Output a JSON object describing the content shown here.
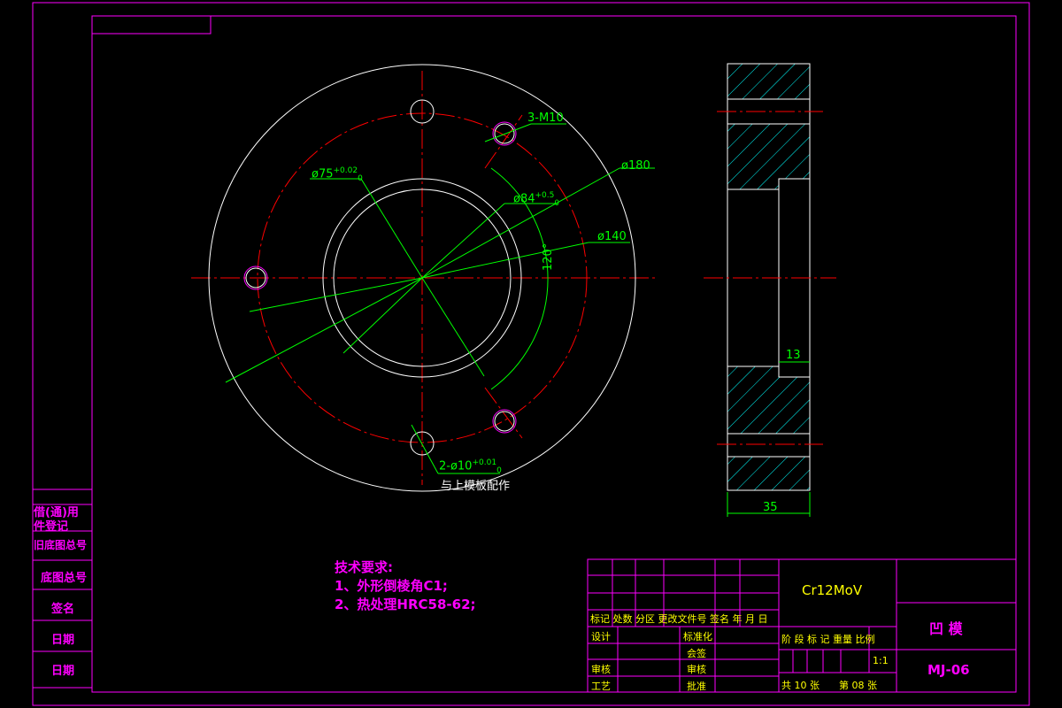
{
  "colors": {
    "frame": "#ff00ff",
    "outline": "#ffffff",
    "center_line": "#ff0000",
    "dimension": "#00ff00",
    "hatch": "#00ffff",
    "title_text": "#ffff00",
    "tech_text": "#ff00ff"
  },
  "dimensions": {
    "thread": "3-M10",
    "dia_180": "ø180",
    "dia_140": "ø140",
    "dia_84": "ø84",
    "dia_84_tol": "+0.5",
    "dia_84_tol_low": "0",
    "dia_75": "ø75",
    "dia_75_tol": "+0.02",
    "dia_75_tol_low": "0",
    "angle": "120°",
    "pin_holes": "2-ø10",
    "pin_tol": "+0.01",
    "pin_tol_low": "0",
    "pin_note": "与上模板配作",
    "depth_13": "13",
    "thickness_35": "35"
  },
  "tech_requirements": {
    "heading": "技术要求:",
    "items": [
      "1、外形倒棱角C1;",
      "2、热处理HRC58-62;"
    ]
  },
  "left_column": [
    "借(通)用",
    "件登记",
    "旧底图总号",
    "底图总号",
    "签名",
    "日期",
    "日期"
  ],
  "title_block": {
    "material": "Cr12MoV",
    "part_name": "凹 模",
    "drawing_no": "MJ-06",
    "header_row": "标记 处数 分区 更改文件号 签名 年 月 日",
    "design": "设计",
    "standardize": "标准化",
    "review": "审核",
    "craft": "工艺",
    "check": "审核",
    "approve_1": "会签",
    "approve_2": "批准",
    "stage_row": "阶 段 标 记  重量  比例",
    "scale": "1:1",
    "total_sheets": "共 10 张",
    "sheet_no": "第 08 张"
  }
}
